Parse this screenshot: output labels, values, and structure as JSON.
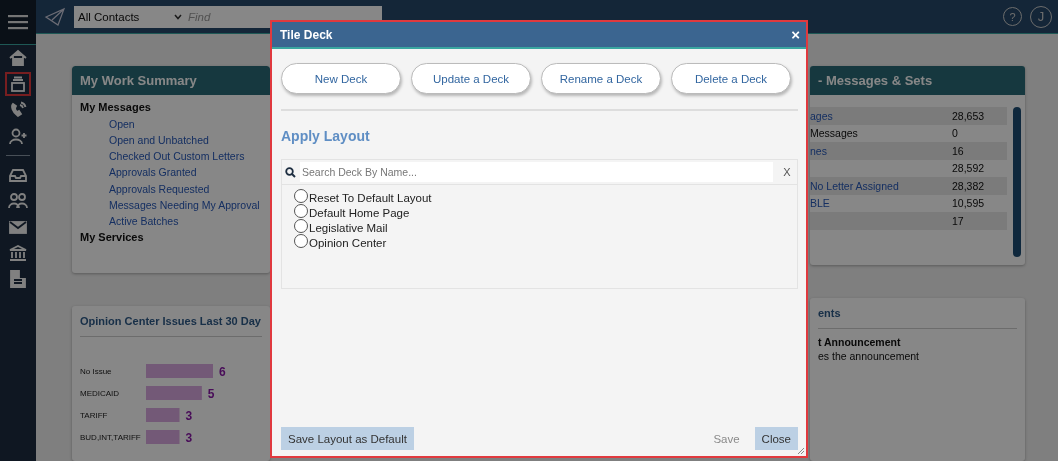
{
  "sidebar": {
    "items": [
      {
        "selected": false
      },
      {
        "selected": true
      },
      {
        "selected": false
      },
      {
        "selected": false
      },
      {
        "selected": false
      },
      {
        "selected": false
      },
      {
        "selected": false
      },
      {
        "selected": false
      },
      {
        "selected": false
      }
    ]
  },
  "top_bar": {
    "contact_filter": "All Contacts",
    "search": {
      "placeholder": "Find"
    },
    "help": "?",
    "user_initial": "J"
  },
  "work_summary": {
    "title": "My Work Summary",
    "sections": [
      {
        "heading": "My Messages",
        "links": [
          "Open",
          "Open and Unbatched",
          "Checked Out Custom Letters",
          "Approvals Granted",
          "Approvals Requested",
          "Messages Needing My Approval",
          "Active Batches"
        ]
      },
      {
        "heading": "My Services"
      }
    ]
  },
  "messages_sets": {
    "title": "- Messages & Sets",
    "rows": [
      {
        "kind": "link",
        "label": "ages",
        "value": "28,653"
      },
      {
        "kind": "plain",
        "label": "Messages",
        "value": "0"
      },
      {
        "kind": "link",
        "label": "nes",
        "value": "16"
      },
      {
        "value": "28,592"
      },
      {
        "kind": "link",
        "label": "No Letter Assigned",
        "value": "28,382"
      },
      {
        "kind": "link",
        "label": "BLE",
        "value": "10,595"
      },
      {
        "value": "17"
      }
    ]
  },
  "opinion_center": {
    "title": "Opinion Center Issues Last 30 Day",
    "chart_data": {
      "type": "bar",
      "orientation": "horizontal",
      "categories": [
        "No Issue",
        "MEDICAID",
        "TARIFF",
        "BUD,INT,TARIFF"
      ],
      "values": [
        6,
        5,
        3,
        3
      ],
      "data_labels": true
    }
  },
  "announcements": {
    "title": "ents",
    "heading": "t Announcement",
    "text": "es the announcement"
  },
  "dialog": {
    "title": "Tile Deck",
    "close": "×",
    "deck_buttons": [
      "New Deck",
      "Update a Deck",
      "Rename a Deck",
      "Delete a Deck"
    ],
    "section_title": "Apply Layout",
    "search": {
      "placeholder": "Search Deck By Name...",
      "clear": "X"
    },
    "layouts": [
      {
        "label": "Reset To Default Layout",
        "selected": false
      },
      {
        "label": "Default Home Page",
        "selected": false
      },
      {
        "label": "Legislative Mail",
        "selected": false
      },
      {
        "label": "Opinion Center",
        "selected": false
      }
    ],
    "footer": [
      {
        "label": "Save Layout as Default",
        "disabled": false
      },
      {
        "label": "Save",
        "disabled": true
      },
      {
        "label": "Close",
        "disabled": false
      }
    ]
  }
}
